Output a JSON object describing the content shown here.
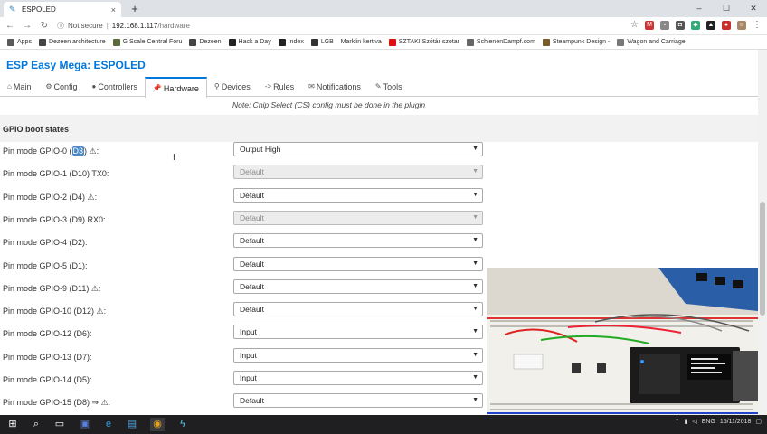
{
  "browser": {
    "tab_title": "ESPOLED",
    "tab_close": "×",
    "new_tab": "+",
    "window_controls": [
      "–",
      "☐",
      "✕"
    ],
    "secure_label": "Not secure",
    "url_host": "192.168.1.117",
    "url_path": "/hardware",
    "bookmarks": [
      {
        "label": "Apps",
        "color": "#5a5a5a"
      },
      {
        "label": "Dezeen architecture",
        "color": "#444"
      },
      {
        "label": "G Scale Central Foru",
        "color": "#5b6b3a"
      },
      {
        "label": "Dezeen",
        "color": "#444"
      },
      {
        "label": "Hack a Day",
        "color": "#222"
      },
      {
        "label": "Index",
        "color": "#222"
      },
      {
        "label": "LGB – Marklin kertiva",
        "color": "#333"
      },
      {
        "label": "SZTAKI Szótár szotar",
        "color": "#d11"
      },
      {
        "label": "SchienenDampf.com",
        "color": "#666"
      },
      {
        "label": "Steampunk Design -",
        "color": "#7a5b2e"
      },
      {
        "label": "Wagon and Carriage",
        "color": "#777"
      }
    ]
  },
  "page": {
    "title": "ESP Easy Mega: ESPOLED",
    "menu": [
      {
        "label": "Main",
        "icon": "⌂"
      },
      {
        "label": "Config",
        "icon": "⚙"
      },
      {
        "label": "Controllers",
        "icon": "●"
      },
      {
        "label": "Hardware",
        "icon": "📌"
      },
      {
        "label": "Devices",
        "icon": "⚲"
      },
      {
        "label": "Rules",
        "icon": "->"
      },
      {
        "label": "Notifications",
        "icon": "✉"
      },
      {
        "label": "Tools",
        "icon": "✎"
      }
    ],
    "active_menu": "Hardware",
    "note": "Note: Chip Select (CS) config must be done in the plugin",
    "section_title": "GPIO boot states",
    "rows": [
      {
        "pre": "Pin mode GPIO-0 (",
        "highlight": "D3",
        "post": ") ⚠:",
        "value": "Output High",
        "disabled": false
      },
      {
        "pre": "Pin mode GPIO-1 (D10) TX0:",
        "highlight": "",
        "post": "",
        "value": "Default",
        "disabled": true
      },
      {
        "pre": "Pin mode GPIO-2 (D4) ⚠:",
        "highlight": "",
        "post": "",
        "value": "Default",
        "disabled": false
      },
      {
        "pre": "Pin mode GPIO-3 (D9) RX0:",
        "highlight": "",
        "post": "",
        "value": "Default",
        "disabled": true
      },
      {
        "pre": "Pin mode GPIO-4 (D2):",
        "highlight": "",
        "post": "",
        "value": "Default",
        "disabled": false
      },
      {
        "pre": "Pin mode GPIO-5 (D1):",
        "highlight": "",
        "post": "",
        "value": "Default",
        "disabled": false
      },
      {
        "pre": "Pin mode GPIO-9 (D11) ⚠:",
        "highlight": "",
        "post": "",
        "value": "Default",
        "disabled": false
      },
      {
        "pre": "Pin mode GPIO-10 (D12) ⚠:",
        "highlight": "",
        "post": "",
        "value": "Default",
        "disabled": false
      },
      {
        "pre": "Pin mode GPIO-12 (D6):",
        "highlight": "",
        "post": "",
        "value": "Input",
        "disabled": false
      },
      {
        "pre": "Pin mode GPIO-13 (D7):",
        "highlight": "",
        "post": "",
        "value": "Input",
        "disabled": false
      },
      {
        "pre": "Pin mode GPIO-14 (D5):",
        "highlight": "",
        "post": "",
        "value": "Input",
        "disabled": false
      },
      {
        "pre": "Pin mode GPIO-15 (D8) ⇒ ⚠:",
        "highlight": "",
        "post": "",
        "value": "Default",
        "disabled": false
      }
    ]
  },
  "taskbar": {
    "lang": "ENG",
    "date": "15/11/2018"
  },
  "colors": {
    "title_blue": "#0077dd",
    "active_tab_border": "#0077dd",
    "section_bg": "#f2f2f2"
  }
}
